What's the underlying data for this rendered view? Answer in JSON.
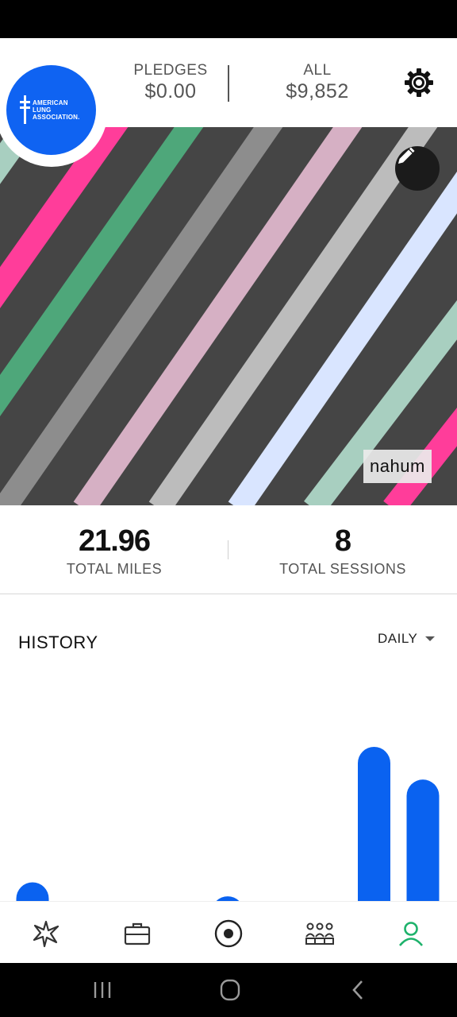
{
  "header": {
    "pledges": {
      "label": "PLEDGES",
      "value": "$0.00"
    },
    "all": {
      "label": "ALL",
      "value": "$9,852"
    }
  },
  "logo": {
    "line1": "AMERICAN",
    "line2": "LUNG",
    "line3": "ASSOCIATION."
  },
  "profile": {
    "username": "nahum"
  },
  "totals": {
    "miles": {
      "value": "21.96",
      "label": "TOTAL MILES"
    },
    "sessions": {
      "value": "8",
      "label": "TOTAL SESSIONS"
    }
  },
  "history": {
    "title": "HISTORY",
    "range": "DAILY"
  },
  "chart_data": {
    "type": "bar",
    "series": [
      {
        "values": [
          0.08,
          0,
          0,
          0,
          0.02,
          0,
          0,
          0.66,
          0.52
        ]
      }
    ],
    "color": "#0a62f0"
  },
  "nav": {
    "items": [
      "sparkle-icon",
      "briefcase-icon",
      "record-icon",
      "team-icon",
      "profile-icon"
    ],
    "active_color": "#1db26b",
    "inactive_color": "#333333"
  },
  "colors": {
    "accent": "#0f63f2",
    "banner_bg": "#454545"
  }
}
